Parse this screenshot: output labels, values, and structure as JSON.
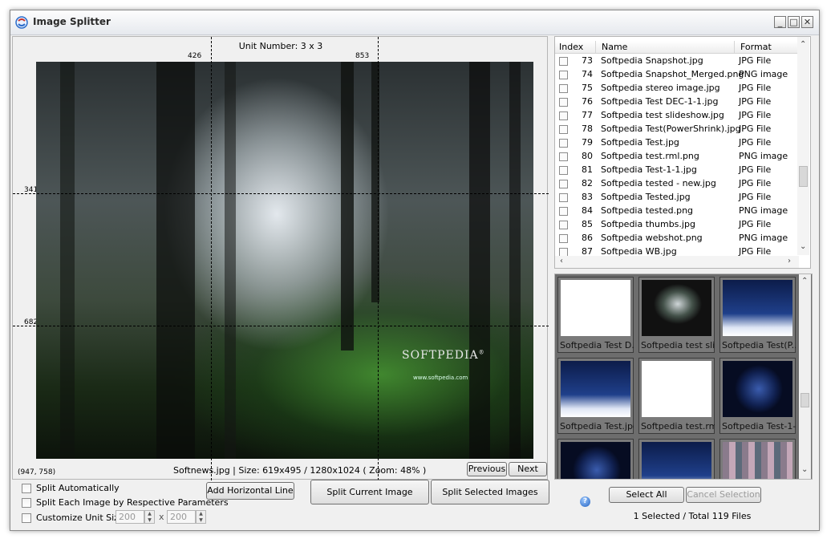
{
  "window": {
    "title": "Image Splitter",
    "minimize": "_",
    "maximize": "□",
    "close": "✕"
  },
  "preview": {
    "unit_label": "Unit Number: 3 x 3",
    "ruler_x": [
      "426",
      "853"
    ],
    "ruler_y": [
      "341",
      "682"
    ],
    "cursor_coords": "(947, 758)",
    "file_info": "Softnews.jpg  |  Size: 619x495 / 1280x1024 ( Zoom: 48% )",
    "watermark_brand": "SOFTPEDIA",
    "watermark_trademark": "®",
    "watermark_url": "www.softpedia.com",
    "previous_label": "Previous",
    "next_label": "Next"
  },
  "file_list": {
    "columns": [
      "Index",
      "Name",
      "Format"
    ],
    "rows": [
      {
        "index": "73",
        "name": "Softpedia Snapshot.jpg",
        "format": "JPG File"
      },
      {
        "index": "74",
        "name": "Softpedia Snapshot_Merged.png",
        "format": "PNG image"
      },
      {
        "index": "75",
        "name": "Softpedia stereo image.jpg",
        "format": "JPG File"
      },
      {
        "index": "76",
        "name": "Softpedia Test DEC-1-1.jpg",
        "format": "JPG File"
      },
      {
        "index": "77",
        "name": "Softpedia test slideshow.jpg",
        "format": "JPG File"
      },
      {
        "index": "78",
        "name": "Softpedia Test(PowerShrink).jpg",
        "format": "JPG File"
      },
      {
        "index": "79",
        "name": "Softpedia Test.jpg",
        "format": "JPG File"
      },
      {
        "index": "80",
        "name": "Softpedia test.rml.png",
        "format": "PNG image"
      },
      {
        "index": "81",
        "name": "Softpedia Test-1-1.jpg",
        "format": "JPG File"
      },
      {
        "index": "82",
        "name": "Softpedia tested - new.jpg",
        "format": "JPG File"
      },
      {
        "index": "83",
        "name": "Softpedia Tested.jpg",
        "format": "JPG File"
      },
      {
        "index": "84",
        "name": "Softpedia tested.png",
        "format": "PNG image"
      },
      {
        "index": "85",
        "name": "Softpedia thumbs.jpg",
        "format": "JPG File"
      },
      {
        "index": "86",
        "name": "Softpedia webshot.png",
        "format": "PNG image"
      },
      {
        "index": "87",
        "name": "Softpedia WB.jpg",
        "format": "JPG File"
      }
    ]
  },
  "thumbnails": [
    {
      "caption": "Softpedia Test D...",
      "style": "doc"
    },
    {
      "caption": "Softpedia test sli...",
      "style": "forest"
    },
    {
      "caption": "Softpedia Test(P...",
      "style": "blue"
    },
    {
      "caption": "Softpedia Test.jpg",
      "style": "blue"
    },
    {
      "caption": "Softpedia test.rml...",
      "style": "doc"
    },
    {
      "caption": "Softpedia Test-1-...",
      "style": "darkblue"
    },
    {
      "caption": "",
      "style": "darkblue"
    },
    {
      "caption": "",
      "style": "blue"
    },
    {
      "caption": "",
      "style": "mosaic"
    }
  ],
  "options": {
    "split_automatically": "Split Automatically",
    "split_each": "Split Each Image by Respective Parameters",
    "customize_unit": "Customize Unit Size",
    "unit_width": "200",
    "unit_height": "200",
    "times": "x"
  },
  "buttons": {
    "add_horizontal_line": "Add Horizontal Line",
    "split_current": "Split Current Image",
    "split_selected": "Split Selected Images",
    "select_all": "Select All",
    "cancel_selection": "Cancel Selection",
    "help": "?"
  },
  "status": "1 Selected / Total 119 Files",
  "colors": {
    "accent": "#1f5fbf",
    "selected_thumb": "#9ab0cf"
  }
}
